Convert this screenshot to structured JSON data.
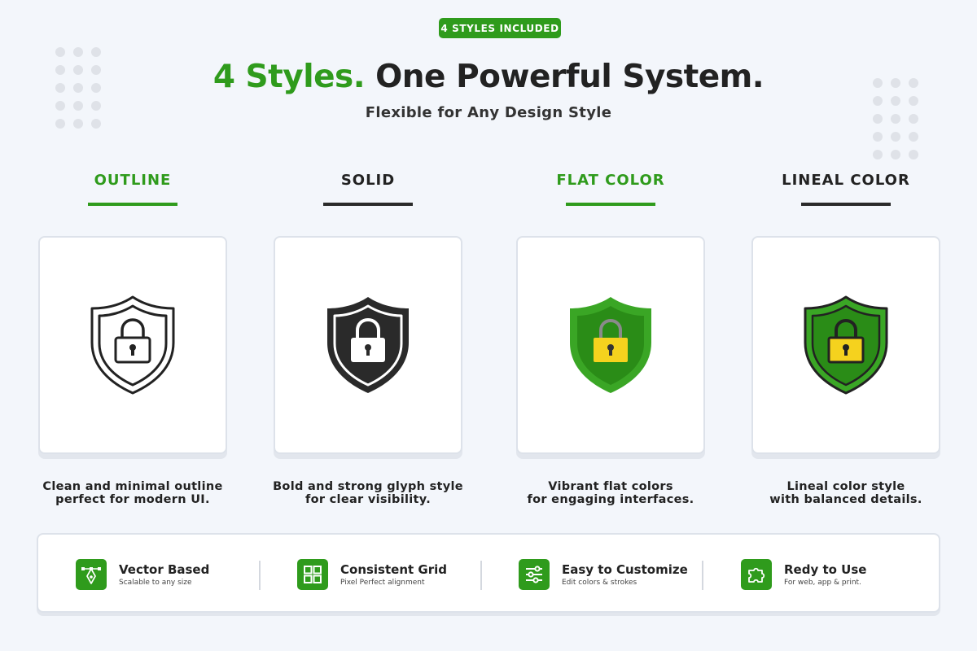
{
  "badge": "4 STYLES INCLUDED",
  "headline": {
    "accent": "4 Styles.",
    "rest": " One Powerful System."
  },
  "subhead": "Flexible for Any Design Style",
  "styles": [
    {
      "title": "OUTLINE",
      "desc_line1": "Clean and minimal outline",
      "desc_line2": "perfect for modern UI."
    },
    {
      "title": "SOLID",
      "desc_line1": "Bold and strong glyph style",
      "desc_line2": "for clear visibility."
    },
    {
      "title": "FLAT COLOR",
      "desc_line1": "Vibrant flat colors",
      "desc_line2": "for engaging interfaces."
    },
    {
      "title": "LINEAL COLOR",
      "desc_line1": "Lineal color style",
      "desc_line2": "with balanced details."
    }
  ],
  "features": [
    {
      "title": "Vector Based",
      "sub": "Scalable to any size",
      "icon": "pen-tool-icon"
    },
    {
      "title": "Consistent Grid",
      "sub": "Pixel Perfect alignment",
      "icon": "grid-icon"
    },
    {
      "title": "Easy to Customize",
      "sub": "Edit colors & strokes",
      "icon": "sliders-icon"
    },
    {
      "title": "Redy to Use",
      "sub": "For web, app & print.",
      "icon": "puzzle-icon"
    }
  ],
  "colors": {
    "accent": "#2f9b1c",
    "dark": "#222222",
    "lock_yellow": "#f5d21e",
    "shield_green_dark": "#1f7a12",
    "background": "#f3f6fb"
  }
}
